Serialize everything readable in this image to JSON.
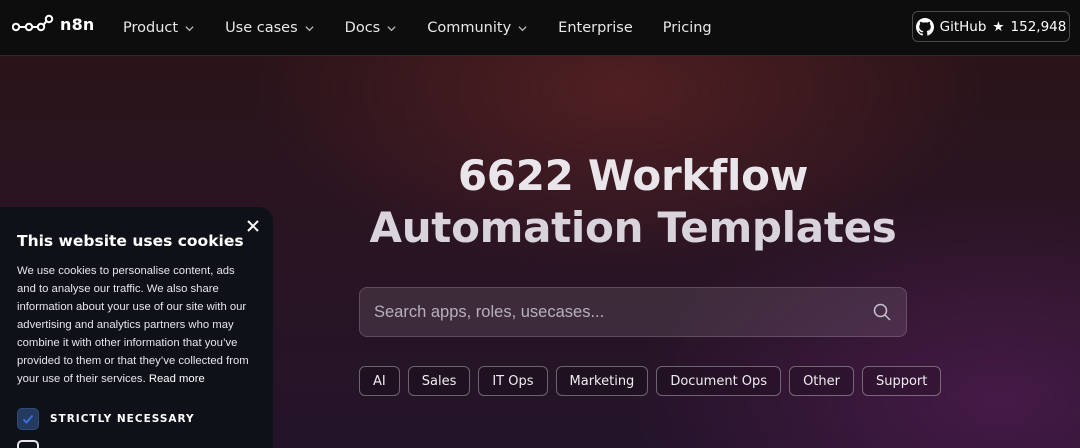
{
  "nav": {
    "brand": "n8n",
    "items": [
      {
        "label": "Product",
        "dropdown": true
      },
      {
        "label": "Use cases",
        "dropdown": true
      },
      {
        "label": "Docs",
        "dropdown": true
      },
      {
        "label": "Community",
        "dropdown": true
      },
      {
        "label": "Enterprise",
        "dropdown": false
      },
      {
        "label": "Pricing",
        "dropdown": false
      }
    ],
    "github": {
      "label": "GitHub",
      "star": "★",
      "count": "152,948",
      "icon": "github-icon"
    }
  },
  "hero": {
    "title_line1": "6622 Workflow",
    "title_line2": "Automation Templates"
  },
  "search": {
    "placeholder": "Search apps, roles, usecases...",
    "value": "",
    "icon": "search-icon"
  },
  "categories": [
    "AI",
    "Sales",
    "IT Ops",
    "Marketing",
    "Document Ops",
    "Other",
    "Support"
  ],
  "cookie": {
    "title": "This website uses cookies",
    "body": "We use cookies to personalise content, ads and to analyse our traffic. We also share information about your use of our site with our advertising and analytics partners who may combine it with other information that you’ve provided to them or that they’ve collected from your use of their services.",
    "read_more": "Read more",
    "options": [
      {
        "label": "STRICTLY NECESSARY",
        "checked": true
      }
    ]
  },
  "colors": {
    "nav_bg": "#0d0d0e",
    "cookie_bg": "#0f1119",
    "checkbox_checked": "#243a5e"
  }
}
